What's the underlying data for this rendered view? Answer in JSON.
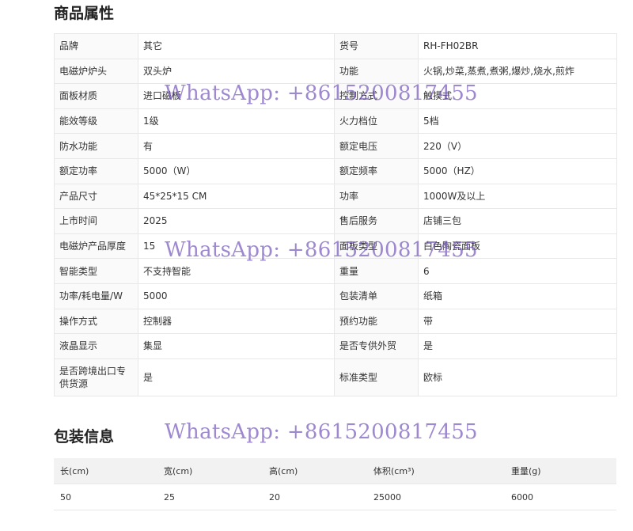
{
  "attributes": {
    "title": "商品属性",
    "rows": [
      [
        {
          "k": "品牌",
          "v": "其它"
        },
        {
          "k": "货号",
          "v": "RH-FH02BR"
        }
      ],
      [
        {
          "k": "电磁炉炉头",
          "v": "双头炉"
        },
        {
          "k": "功能",
          "v": "火锅,炒菜,蒸煮,煮粥,爆炒,烧水,煎炸"
        }
      ],
      [
        {
          "k": "面板材质",
          "v": "进口磁板"
        },
        {
          "k": "控制方式",
          "v": "触摸式"
        }
      ],
      [
        {
          "k": "能效等级",
          "v": "1级"
        },
        {
          "k": "火力档位",
          "v": "5档"
        }
      ],
      [
        {
          "k": "防水功能",
          "v": "有"
        },
        {
          "k": "额定电压",
          "v": "220（V）"
        }
      ],
      [
        {
          "k": "额定功率",
          "v": "5000（W）"
        },
        {
          "k": "额定频率",
          "v": "5000（HZ）"
        }
      ],
      [
        {
          "k": "产品尺寸",
          "v": "45*25*15 CM"
        },
        {
          "k": "功率",
          "v": "1000W及以上"
        }
      ],
      [
        {
          "k": "上市时间",
          "v": "2025"
        },
        {
          "k": "售后服务",
          "v": "店铺三包"
        }
      ],
      [
        {
          "k": "电磁炉产品厚度",
          "v": "15"
        },
        {
          "k": "面板类型",
          "v": "白色陶瓷面板"
        }
      ],
      [
        {
          "k": "智能类型",
          "v": "不支持智能"
        },
        {
          "k": "重量",
          "v": "6"
        }
      ],
      [
        {
          "k": "功率/耗电量/W",
          "v": "5000"
        },
        {
          "k": "包装清单",
          "v": "纸箱"
        }
      ],
      [
        {
          "k": "操作方式",
          "v": "控制器"
        },
        {
          "k": "预约功能",
          "v": "带"
        }
      ],
      [
        {
          "k": "液晶显示",
          "v": "集显"
        },
        {
          "k": "是否专供外贸",
          "v": "是"
        }
      ],
      [
        {
          "k": "是否跨境出口专供货源",
          "v": "是"
        },
        {
          "k": "标准类型",
          "v": "欧标"
        }
      ]
    ]
  },
  "packaging": {
    "title": "包装信息",
    "headers": [
      "长(cm)",
      "宽(cm)",
      "高(cm)",
      "体积(cm³)",
      "重量(g)"
    ],
    "values": [
      "50",
      "25",
      "20",
      "25000",
      "6000"
    ]
  },
  "watermark": {
    "text": "WhatsApp: +8615200817455",
    "color": "#785abe"
  }
}
